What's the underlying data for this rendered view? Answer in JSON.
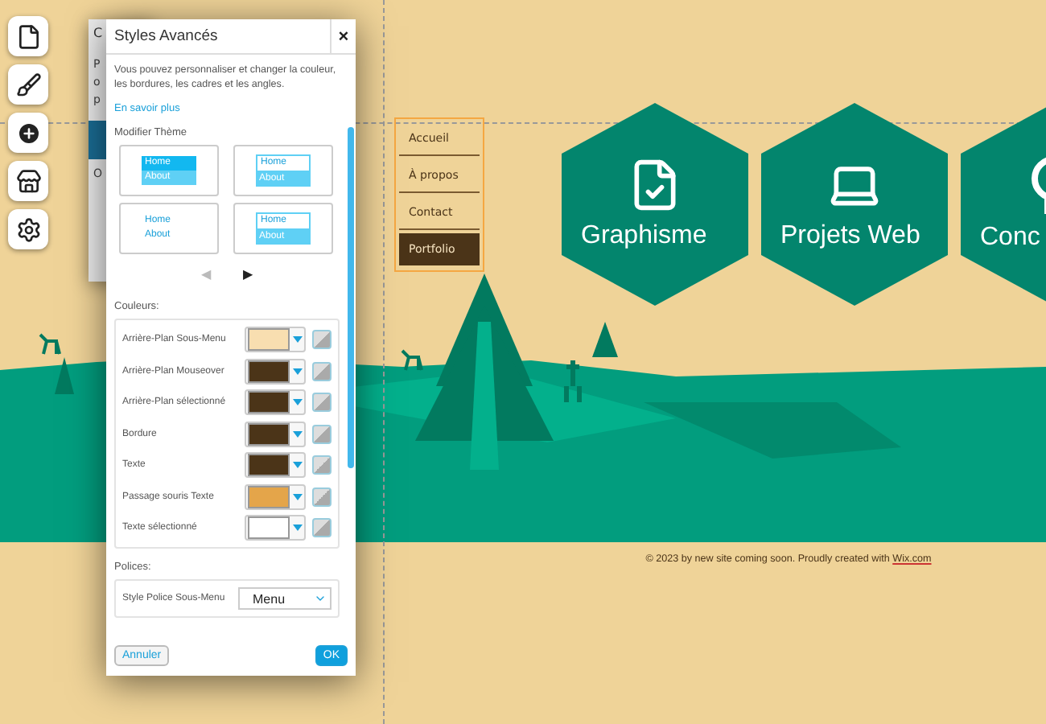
{
  "site": {
    "menu": [
      {
        "label": "Accueil",
        "selected": false
      },
      {
        "label": "À propos",
        "selected": false
      },
      {
        "label": "Contact",
        "selected": false
      },
      {
        "label": "Portfolio",
        "selected": true
      }
    ],
    "tiles": [
      {
        "kind": "document",
        "label": "Graphisme"
      },
      {
        "kind": "laptop",
        "label": "Projets Web"
      },
      {
        "kind": "bulb",
        "label": "Conc"
      }
    ],
    "footer": {
      "text": "© 2023 by new site coming soon. Proudly created with ",
      "link": "Wix.com"
    }
  },
  "back_dialog": {
    "title": "C",
    "lines": [
      "P",
      "o",
      "p"
    ],
    "label": "O"
  },
  "dialog": {
    "title": "Styles Avancés",
    "close": "×",
    "description": "Vous pouvez personnaliser et changer la couleur, les bordures, les cadres et les angles.",
    "link": "En savoir plus",
    "theme_heading": "Modifier Thème",
    "themes": [
      {
        "kind": "filled",
        "items": [
          "Home",
          "About"
        ]
      },
      {
        "kind": "outlined",
        "items": [
          "Home",
          "About"
        ]
      },
      {
        "kind": "plain",
        "items": [
          "Home",
          "About"
        ]
      },
      {
        "kind": "boxed",
        "items": [
          "Home",
          "About"
        ]
      }
    ],
    "pager": {
      "prev": "◀",
      "next": "▶"
    },
    "colors_heading": "Couleurs:",
    "colors": [
      {
        "label": "Arrière-Plan Sous-Menu",
        "color": "#f8deb0"
      },
      {
        "label": "Arrière-Plan Mouseover",
        "color": "#4b3418"
      },
      {
        "label": "Arrière-Plan sélectionné",
        "color": "#4b3418"
      },
      {
        "label": "Bordure",
        "color": "#4b3418"
      },
      {
        "label": "Texte",
        "color": "#4b3418"
      },
      {
        "label": "Passage souris Texte",
        "color": "#e4a54a"
      },
      {
        "label": "Texte sélectionné",
        "color": "#ffffff"
      }
    ],
    "fonts_heading": "Polices:",
    "fonts": [
      {
        "label": "Style Police Sous-Menu",
        "value": "Menu"
      }
    ],
    "buttons": {
      "cancel": "Annuler",
      "ok": "OK"
    }
  }
}
